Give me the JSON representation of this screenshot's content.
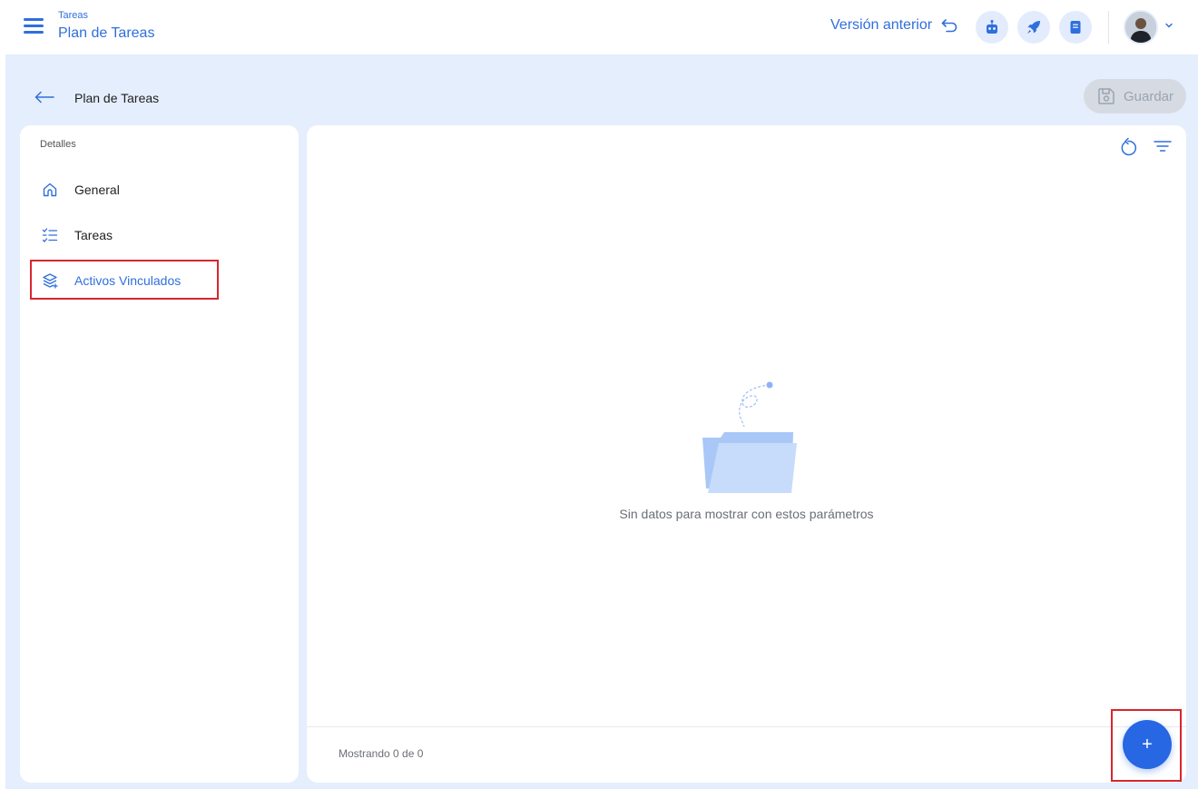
{
  "header": {
    "breadcrumb_small": "Tareas",
    "breadcrumb_title": "Plan de Tareas",
    "prev_version_label": "Versión anterior",
    "action_icons": [
      "robot-icon",
      "rocket-icon",
      "document-icon"
    ]
  },
  "toolbar": {
    "page_title": "Plan de Tareas",
    "save_label": "Guardar"
  },
  "sidebar": {
    "section_label": "Detalles",
    "items": [
      {
        "label": "General",
        "icon": "home-icon",
        "active": false
      },
      {
        "label": "Tareas",
        "icon": "checklist-icon",
        "active": false
      },
      {
        "label": "Activos Vinculados",
        "icon": "layers-icon",
        "active": true
      }
    ]
  },
  "main": {
    "empty_message": "Sin datos para mostrar con estos parámetros",
    "footer_text": "Mostrando 0 de 0"
  },
  "fab": {
    "label": "+"
  },
  "colors": {
    "accent": "#2f6fdd",
    "background": "#e5eefd",
    "highlight": "#d7262e",
    "fab": "#2767e3"
  }
}
